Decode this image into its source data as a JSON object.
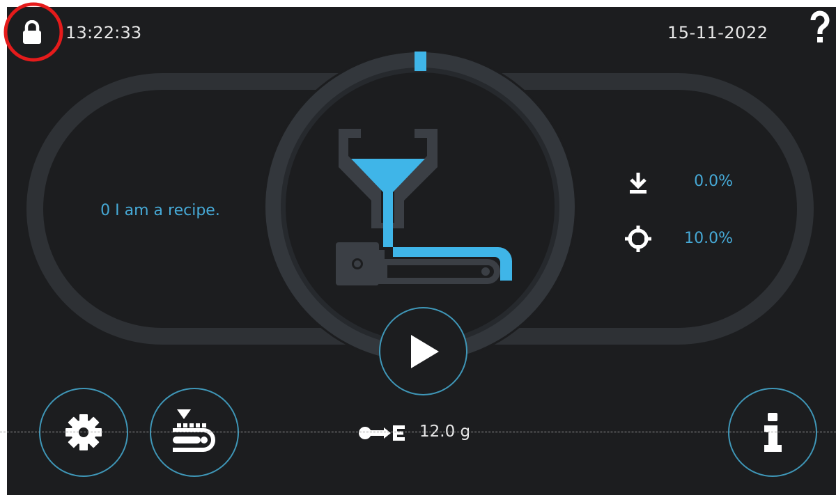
{
  "header": {
    "time": "13:22:33",
    "date": "15-11-2022",
    "lock_icon": "lock-icon",
    "help_icon": "question-mark-icon"
  },
  "recipe": {
    "label": "0 I am a recipe."
  },
  "process": {
    "icon": "hopper-dosing-unit-icon",
    "progress_indicator_color": "#3fb5e8"
  },
  "stats": {
    "dosed_icon": "download-arrow-icon",
    "dosed_value": "0.0%",
    "target_icon": "crosshair-target-icon",
    "target_value": "10.0%"
  },
  "controls": {
    "play_icon": "play-icon",
    "settings_icon": "gear-icon",
    "dosing_icon": "dosing-conveyor-icon",
    "info_icon": "info-icon"
  },
  "weight": {
    "icon": "shot-weight-icon",
    "value": "12.0 g"
  },
  "colors": {
    "accent": "#46a9d6",
    "highlight_circle": "#e51b1b",
    "background": "#1c1d1f",
    "ring": "#3a3d42"
  }
}
